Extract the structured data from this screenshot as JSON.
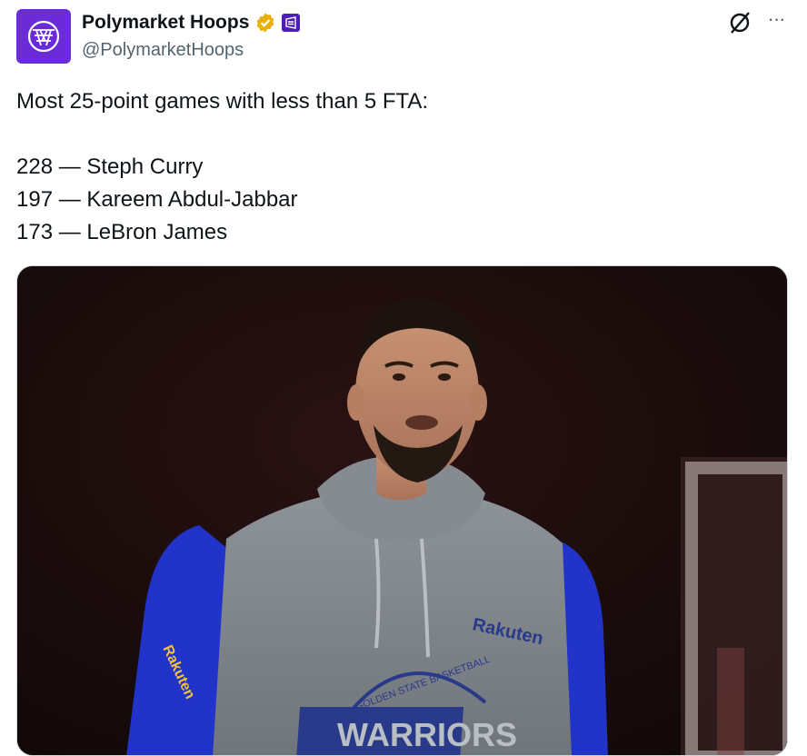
{
  "author": {
    "display_name": "Polymarket Hoops",
    "handle": "@PolymarketHoops",
    "avatar_icon": "basketball-net-icon",
    "verified_badge_color": "#e7b10a",
    "affiliate_badge_color": "#4d1fb8"
  },
  "tweet": {
    "lines": [
      "Most 25-point games with less than 5 FTA:",
      "228 — Steph Curry",
      "197 — Kareem Abdul-Jabbar",
      "173 — LeBron James"
    ]
  },
  "media": {
    "description_icon": "player-photo",
    "jersey": {
      "sponsor": "Rakuten",
      "arc_text": "GOLDEN STATE BASKETBALL",
      "team": "WARRIORS"
    }
  },
  "actions": {
    "grok_icon": "grok-icon",
    "more_icon": "more-horizontal-icon",
    "more_label": "···"
  },
  "colors": {
    "text": "#0f1419",
    "secondary": "#536471",
    "avatar_bg": "#6b2bd9"
  }
}
